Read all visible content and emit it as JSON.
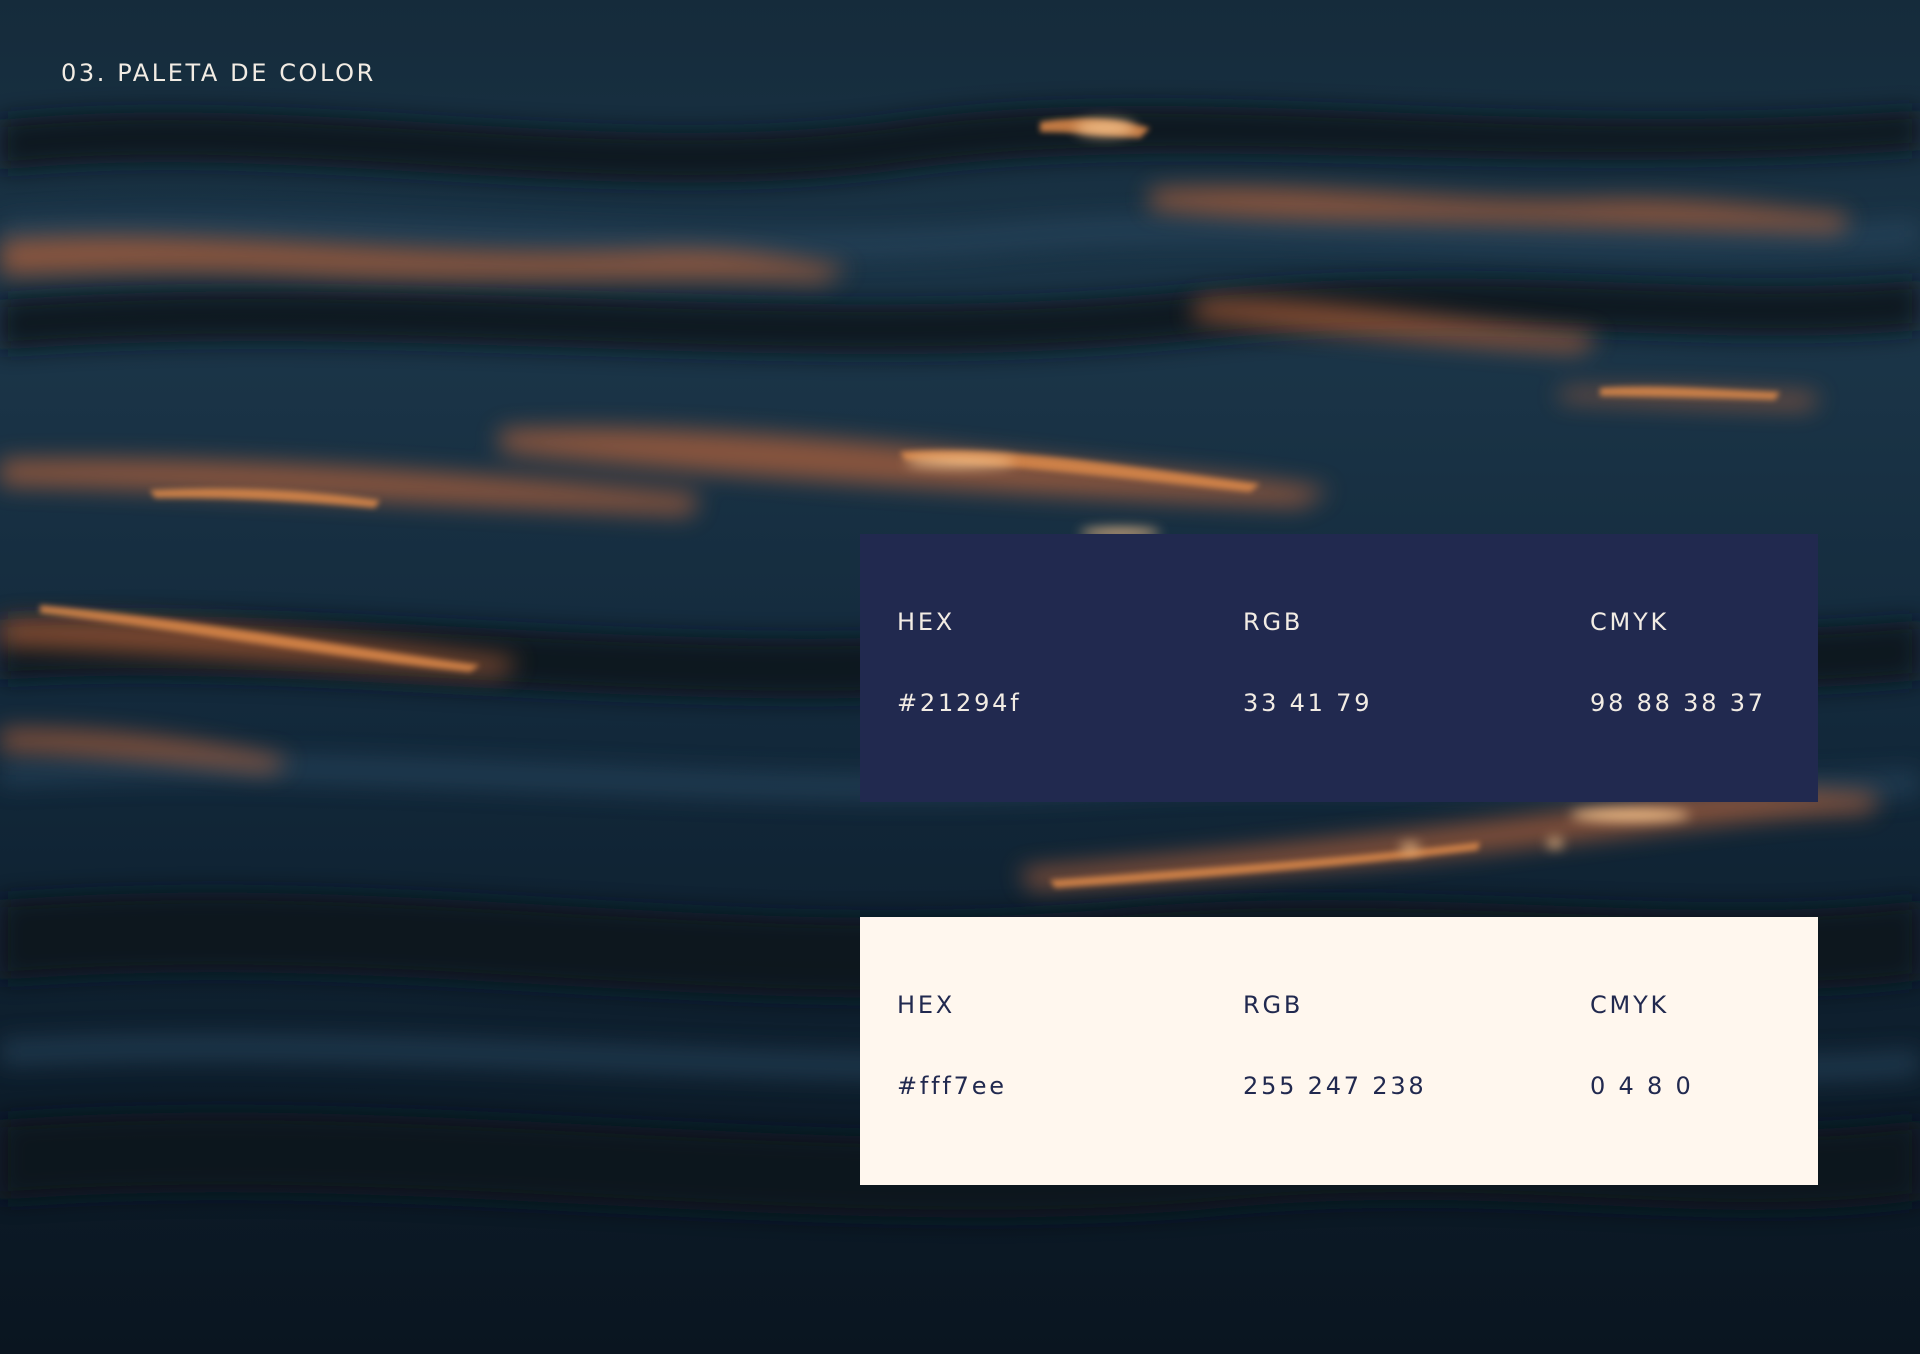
{
  "page": {
    "title": "03. PALETA DE COLOR"
  },
  "colors": {
    "page_text": "#f2ece4",
    "water_dark": "#0b1a26",
    "water_mid": "#1c3a50",
    "highlight_orange": "#d87a3c"
  },
  "swatches": [
    {
      "background": "#21294f",
      "text_color": "#f2ece4",
      "hex_label": "HEX",
      "rgb_label": "RGB",
      "cmyk_label": "CMYK",
      "hex_value": "#21294f",
      "rgb_value": "33 41 79",
      "cmyk_value": "98 88 38 37"
    },
    {
      "background": "#fff7ee",
      "text_color": "#21294f",
      "hex_label": "HEX",
      "rgb_label": "RGB",
      "cmyk_label": "CMYK",
      "hex_value": "#fff7ee",
      "rgb_value": "255 247 238",
      "cmyk_value": "0 4 8 0"
    }
  ]
}
